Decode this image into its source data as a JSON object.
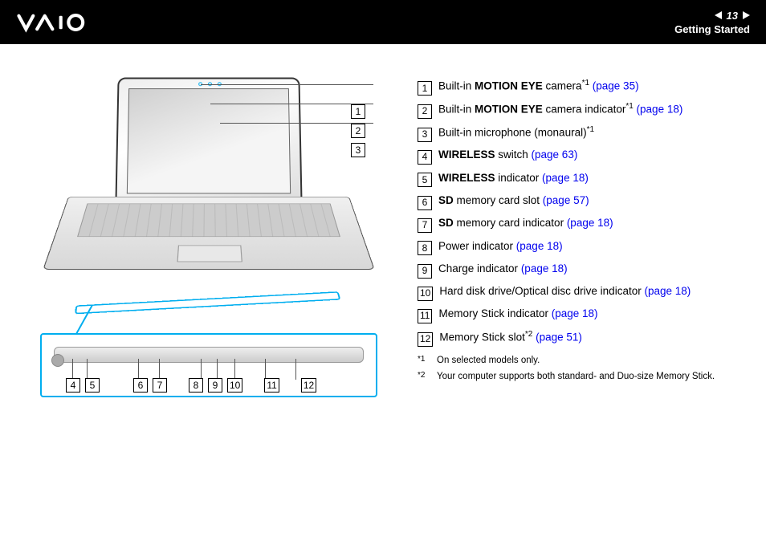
{
  "header": {
    "logo_text": "VAIO",
    "page_number": "13",
    "section": "Getting Started"
  },
  "callouts": {
    "c1": "1",
    "c2": "2",
    "c3": "3",
    "c4": "4",
    "c5": "5",
    "c6": "6",
    "c7": "7",
    "c8": "8",
    "c9": "9",
    "c10": "10",
    "c11": "11",
    "c12": "12"
  },
  "items": [
    {
      "num": "1",
      "pre": "Built-in ",
      "bold": "MOTION EYE",
      "post": " camera",
      "sup": "*1",
      "link": "(page 35)"
    },
    {
      "num": "2",
      "pre": "Built-in ",
      "bold": "MOTION EYE",
      "post": " camera indicator",
      "sup": "*1",
      "link": "(page 18)"
    },
    {
      "num": "3",
      "pre": "Built-in microphone (monaural)",
      "bold": "",
      "post": "",
      "sup": "*1",
      "link": ""
    },
    {
      "num": "4",
      "pre": "",
      "bold": "WIRELESS",
      "post": " switch ",
      "sup": "",
      "link": "(page 63)"
    },
    {
      "num": "5",
      "pre": "",
      "bold": "WIRELESS",
      "post": " indicator ",
      "sup": "",
      "link": "(page 18)"
    },
    {
      "num": "6",
      "pre": "",
      "bold": "SD",
      "post": " memory card slot ",
      "sup": "",
      "link": "(page 57)"
    },
    {
      "num": "7",
      "pre": "",
      "bold": "SD",
      "post": " memory card indicator ",
      "sup": "",
      "link": "(page 18)"
    },
    {
      "num": "8",
      "pre": "Power indicator ",
      "bold": "",
      "post": "",
      "sup": "",
      "link": "(page 18)"
    },
    {
      "num": "9",
      "pre": "Charge indicator ",
      "bold": "",
      "post": "",
      "sup": "",
      "link": "(page 18)"
    },
    {
      "num": "10",
      "pre": "Hard disk drive/Optical disc drive indicator ",
      "bold": "",
      "post": "",
      "sup": "",
      "link": "(page 18)"
    },
    {
      "num": "11",
      "pre": "Memory Stick indicator ",
      "bold": "",
      "post": "",
      "sup": "",
      "link": "(page 18)"
    },
    {
      "num": "12",
      "pre": "Memory Stick slot",
      "bold": "",
      "post": "",
      "sup": "*2",
      "link": " (page 51)"
    }
  ],
  "footnotes": [
    {
      "mark": "*1",
      "text": "On selected models only."
    },
    {
      "mark": "*2",
      "text": "Your computer supports both standard- and Duo-size Memory Stick."
    }
  ]
}
